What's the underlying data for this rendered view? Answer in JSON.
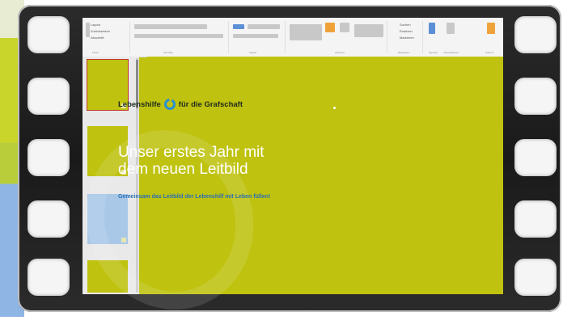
{
  "ribbon": {
    "clipboard_items": [
      "Layout",
      "Zurücksetzen",
      "Abschnitt"
    ],
    "groups": [
      "Folien",
      "Schriftart",
      "Absatz",
      "Zeichnen",
      "Bearbeiten",
      "Sprache",
      "Vertraulichkeit",
      "Add-Ins"
    ],
    "edit_items": [
      "Suchen",
      "Ersetzen",
      "Markieren"
    ],
    "sensitivity_label": "Vertraulichkeit"
  },
  "slide": {
    "logo_left": "Lebenshilfe",
    "logo_right": "für die Grafschaft",
    "title": "Unser erstes Jahr mit\ndem neuen Leitbild",
    "subtitle": "Gemeinsam das Leitbild der Lebenshilf mit Leben füllen!"
  },
  "colors": {
    "slide_bg": "#bfc20e",
    "film": "#222222",
    "accent_blue": "#2a6fb3"
  }
}
